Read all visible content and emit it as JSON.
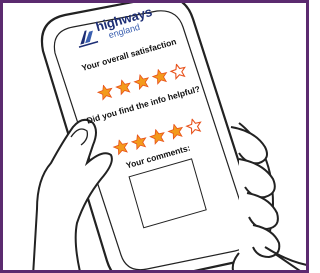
{
  "logo": {
    "name": "highways",
    "sub": "england"
  },
  "survey": {
    "question_satisfaction": "Your overall satisfaction",
    "question_helpful": "Did you find the info helpful?",
    "comments_label": "Your comments:",
    "rating_satisfaction": {
      "filled": 4,
      "max": 5
    },
    "rating_helpful": {
      "filled": 4,
      "max": 5
    }
  },
  "colors": {
    "frame_border": "#5b2a6f",
    "star_fill": "#f39a1c",
    "star_outline": "#e8511a",
    "brand_dark": "#1d2e75",
    "brand_light": "#3a5fb0"
  },
  "icons": [
    "highways-logo-icon",
    "star-icon"
  ]
}
